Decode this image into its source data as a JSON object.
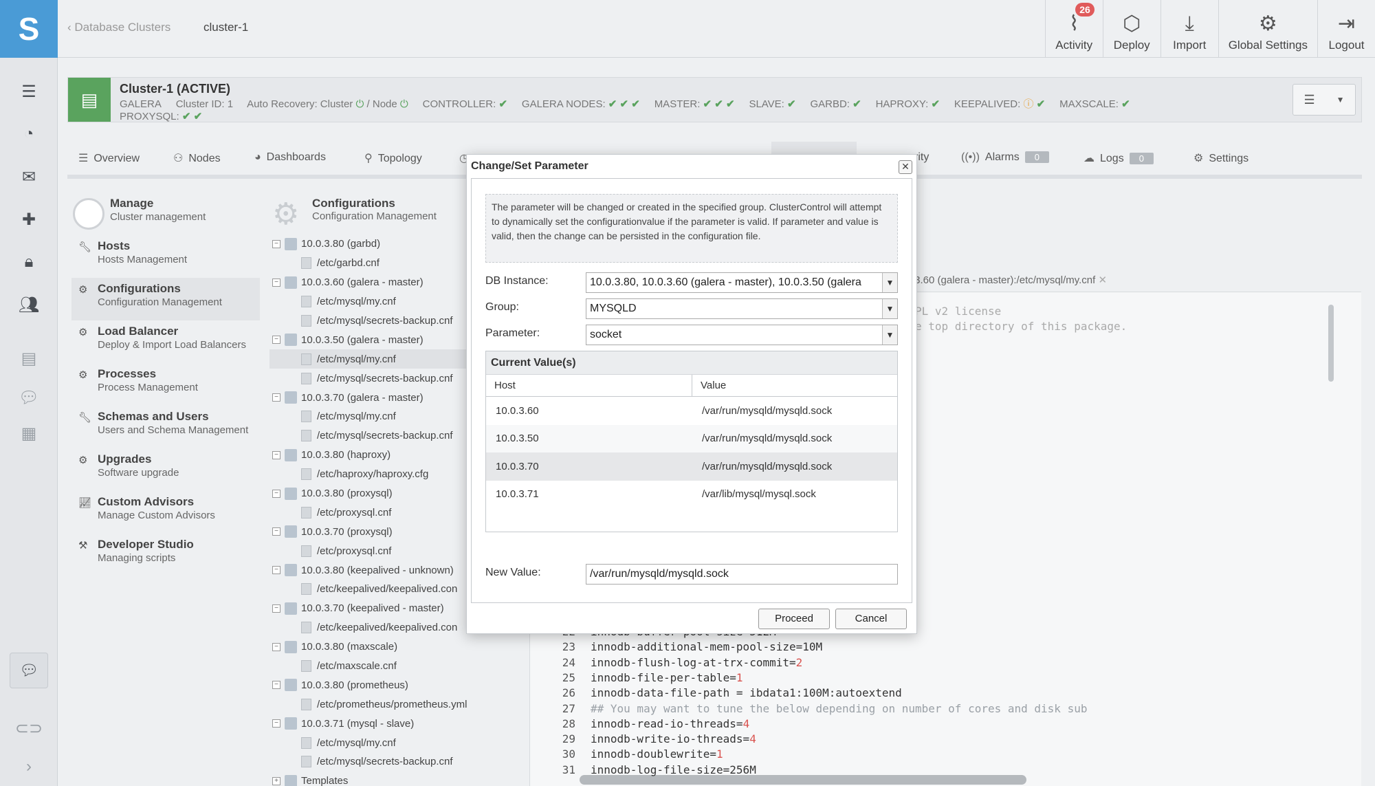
{
  "sidebar": {
    "logo": "S",
    "icons": [
      "clusters-icon",
      "dashboard-pie-icon",
      "mail-icon",
      "puzzle-icon",
      "lock-icon",
      "users-icon",
      "book-icon",
      "comment-icon",
      "gift-icon"
    ],
    "bottom_icons": [
      "chat-icon",
      "toggle-icon",
      "chevron-right-icon"
    ]
  },
  "header": {
    "breadcrumb_parent": "Database Clusters",
    "breadcrumb_current": "cluster-1",
    "actions": [
      {
        "label": "Activity",
        "badge": "26"
      },
      {
        "label": "Deploy"
      },
      {
        "label": "Import"
      },
      {
        "label": "Global Settings"
      },
      {
        "label": "Logout"
      }
    ]
  },
  "cluster": {
    "title": "Cluster-1 (ACTIVE)",
    "type": "GALERA",
    "id_label": "Cluster ID: 1",
    "auto_recovery_cluster": "Auto Recovery: Cluster",
    "auto_recovery_node": "/ Node",
    "controller": "CONTROLLER:",
    "galera_nodes": "GALERA NODES:",
    "master": "MASTER:",
    "slave": "SLAVE:",
    "garbd": "GARBD:",
    "haproxy": "HAPROXY:",
    "keepalived": "KEEPALIVED:",
    "maxscale": "MAXSCALE:",
    "proxysql": "PROXYSQL:"
  },
  "tabs": {
    "overview": "Overview",
    "nodes": "Nodes",
    "dashboards": "Dashboards",
    "topology": "Topology",
    "security_partial": "rity",
    "alarms": "Alarms",
    "alarms_count": "0",
    "logs": "Logs",
    "logs_count": "0",
    "settings": "Settings"
  },
  "manage": {
    "title": "Manage",
    "subtitle": "Cluster management",
    "items": [
      {
        "title": "Hosts",
        "sub": "Hosts Management"
      },
      {
        "title": "Configurations",
        "sub": "Configuration Management"
      },
      {
        "title": "Load Balancer",
        "sub": "Deploy & Import Load Balancers"
      },
      {
        "title": "Processes",
        "sub": "Process Management"
      },
      {
        "title": "Schemas and Users",
        "sub": "Users and Schema Management"
      },
      {
        "title": "Upgrades",
        "sub": "Software upgrade"
      },
      {
        "title": "Custom Advisors",
        "sub": "Manage Custom Advisors"
      },
      {
        "title": "Developer Studio",
        "sub": "Managing scripts"
      }
    ]
  },
  "config": {
    "title": "Configurations",
    "subtitle": "Configuration Management",
    "tree": [
      "10.0.3.80 (garbd)",
      "/etc/garbd.cnf",
      "10.0.3.60 (galera - master)",
      "/etc/mysql/my.cnf",
      "/etc/mysql/secrets-backup.cnf",
      "10.0.3.50 (galera - master)",
      "/etc/mysql/my.cnf",
      "/etc/mysql/secrets-backup.cnf",
      "10.0.3.70 (galera - master)",
      "/etc/mysql/my.cnf",
      "/etc/mysql/secrets-backup.cnf",
      "10.0.3.80 (haproxy)",
      "/etc/haproxy/haproxy.cfg",
      "10.0.3.80 (proxysql)",
      "/etc/proxysql.cnf",
      "10.0.3.70 (proxysql)",
      "/etc/proxysql.cnf",
      "10.0.3.80 (keepalived - unknown)",
      "/etc/keepalived/keepalived.con",
      "10.0.3.70 (keepalived - master)",
      "/etc/keepalived/keepalived.con",
      "10.0.3.80 (maxscale)",
      "/etc/maxscale.cnf",
      "10.0.3.80 (prometheus)",
      "/etc/prometheus/prometheus.yml",
      "10.0.3.71 (mysql - slave)",
      "/etc/mysql/my.cnf",
      "/etc/mysql/secrets-backup.cnf",
      "Templates"
    ]
  },
  "editor": {
    "file_tab": ".3.60 (galera - master):/etc/mysql/my.cnf",
    "top_line1": "PL v2 license",
    "top_line2": "e top directory of this package.",
    "lines": [
      {
        "n": "22",
        "t": "innodb-buffer-pool-size=512M"
      },
      {
        "n": "23",
        "t": "innodb-additional-mem-pool-size=10M"
      },
      {
        "n": "24",
        "t": "innodb-flush-log-at-trx-commit=",
        "v": "2"
      },
      {
        "n": "25",
        "t": "innodb-file-per-table=",
        "v": "1"
      },
      {
        "n": "26",
        "t": "innodb-data-file-path = ibdata1:100M:autoextend"
      },
      {
        "n": "27",
        "t": "## You may want to tune the below depending on number of cores and disk sub",
        "c": true
      },
      {
        "n": "28",
        "t": "innodb-read-io-threads=",
        "v": "4"
      },
      {
        "n": "29",
        "t": "innodb-write-io-threads=",
        "v": "4"
      },
      {
        "n": "30",
        "t": "innodb-doublewrite=",
        "v": "1"
      },
      {
        "n": "31",
        "t": "innodb-log-file-size=256M"
      }
    ]
  },
  "modal": {
    "title": "Change/Set Parameter",
    "info": "The parameter will be changed or created in the specified group. ClusterControl will attempt to dynamically set the configurationvalue if the parameter is valid. If parameter and value is valid, then the change can be persisted in the configuration file.",
    "db_instance_label": "DB Instance:",
    "db_instance_value": "10.0.3.80, 10.0.3.60 (galera - master), 10.0.3.50 (galera",
    "group_label": "Group:",
    "group_value": "MYSQLD",
    "parameter_label": "Parameter:",
    "parameter_value": "socket",
    "current_values_title": "Current Value(s)",
    "col_host": "Host",
    "col_value": "Value",
    "rows": [
      {
        "host": "10.0.3.60",
        "value": "/var/run/mysqld/mysqld.sock"
      },
      {
        "host": "10.0.3.50",
        "value": "/var/run/mysqld/mysqld.sock"
      },
      {
        "host": "10.0.3.70",
        "value": "/var/run/mysqld/mysqld.sock"
      },
      {
        "host": "10.0.3.71",
        "value": "/var/lib/mysql/mysql.sock"
      }
    ],
    "new_value_label": "New Value:",
    "new_value": "/var/run/mysqld/mysqld.sock",
    "proceed": "Proceed",
    "cancel": "Cancel"
  }
}
